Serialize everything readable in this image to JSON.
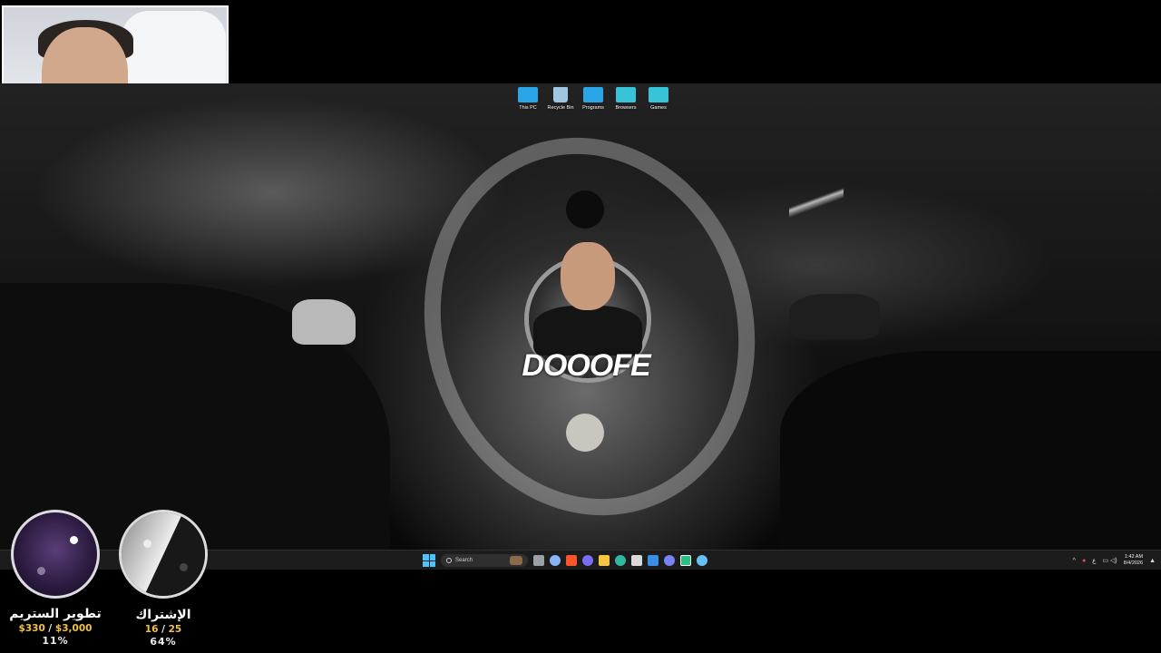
{
  "desktop_icons": [
    {
      "label": "This PC",
      "icon": "monitor-icon",
      "color": "#2aa6e8"
    },
    {
      "label": "Recycle Bin",
      "icon": "recycle-bin-icon",
      "color": "#9ec6e0"
    },
    {
      "label": "Programs",
      "icon": "folder-icon",
      "color": "#2aa6e8"
    },
    {
      "label": "Browsers",
      "icon": "folder-icon",
      "color": "#38c4d8"
    },
    {
      "label": "Games",
      "icon": "folder-icon",
      "color": "#38c4d8"
    }
  ],
  "wallpaper": {
    "logo_text": "DOOOFE"
  },
  "taskbar": {
    "search_label": "Search",
    "apps": [
      {
        "name": "task-view",
        "color": "#9aa0a6"
      },
      {
        "name": "settings",
        "color": "#8ab4f8"
      },
      {
        "name": "brave",
        "color": "#fb542b"
      },
      {
        "name": "copilot",
        "color": "#7b6cf6"
      },
      {
        "name": "file-explorer",
        "color": "#f4c542"
      },
      {
        "name": "edge",
        "color": "#2fb8a2"
      },
      {
        "name": "store",
        "color": "#d9d9d9"
      },
      {
        "name": "mail",
        "color": "#3a8ee6"
      },
      {
        "name": "discord",
        "color": "#7983f5"
      },
      {
        "name": "spotify-like",
        "color": "#26c281"
      },
      {
        "name": "steam",
        "color": "#66c0f4"
      }
    ],
    "tray": {
      "chevron": "^",
      "input_lang": "ع",
      "time": "1:42 AM",
      "date": "8/4/2026"
    }
  },
  "overlay": {
    "stream_goal": {
      "title": "تطوير الستريم",
      "current": "$330",
      "separator": "/",
      "target": "$3,000",
      "percent": "11%"
    },
    "sub_goal": {
      "title": "الإشتراك",
      "current": "16",
      "separator": "/",
      "target": "25",
      "percent": "64%"
    }
  }
}
